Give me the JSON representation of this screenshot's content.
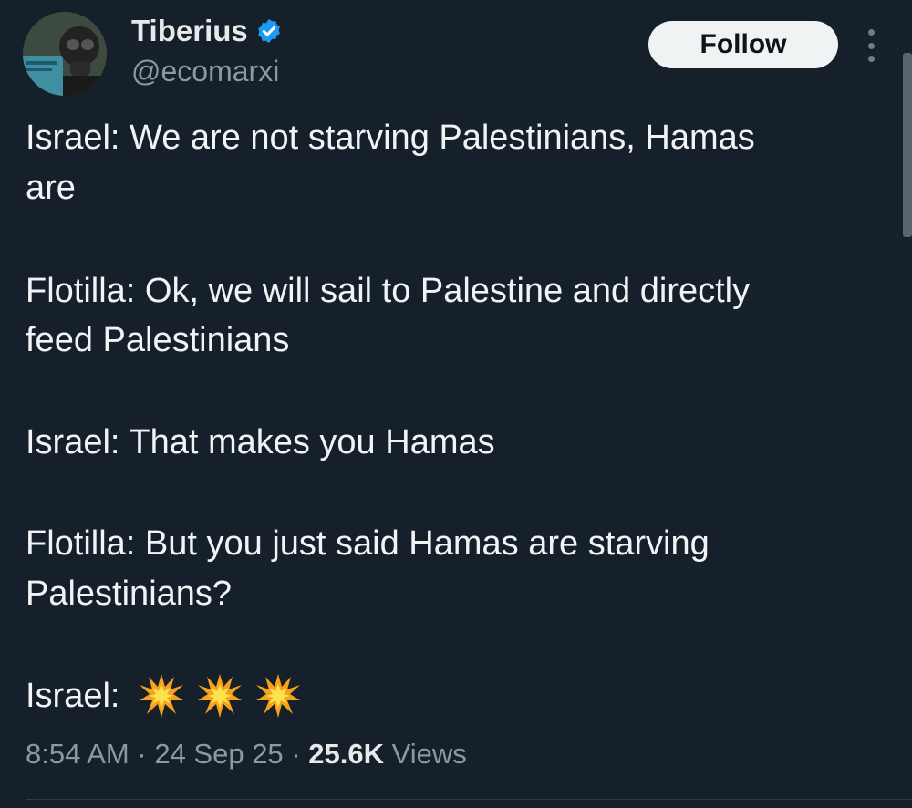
{
  "author": {
    "name": "Tiberius",
    "handle": "@ecomarxi",
    "verified": true
  },
  "actions": {
    "follow_label": "Follow"
  },
  "tweet": {
    "lines": [
      "Israel: We are not starving Palestinians, Hamas",
      "are",
      "Flotilla: Ok, we will sail to Palestine and directly",
      "feed Palestinians",
      "Israel: That makes you Hamas",
      "Flotilla: But you just said Hamas are starving",
      "Palestinians?",
      "Israel:"
    ],
    "emojis": [
      "collision-icon",
      "collision-icon",
      "collision-icon"
    ]
  },
  "meta": {
    "time": "8:54 AM",
    "separator": "·",
    "date": "24 Sep 25",
    "views_count": "25.6K",
    "views_label": "Views"
  },
  "colors": {
    "background": "#15202b",
    "verified_blue": "#1d9bf0",
    "secondary_text": "#8b98a5"
  }
}
